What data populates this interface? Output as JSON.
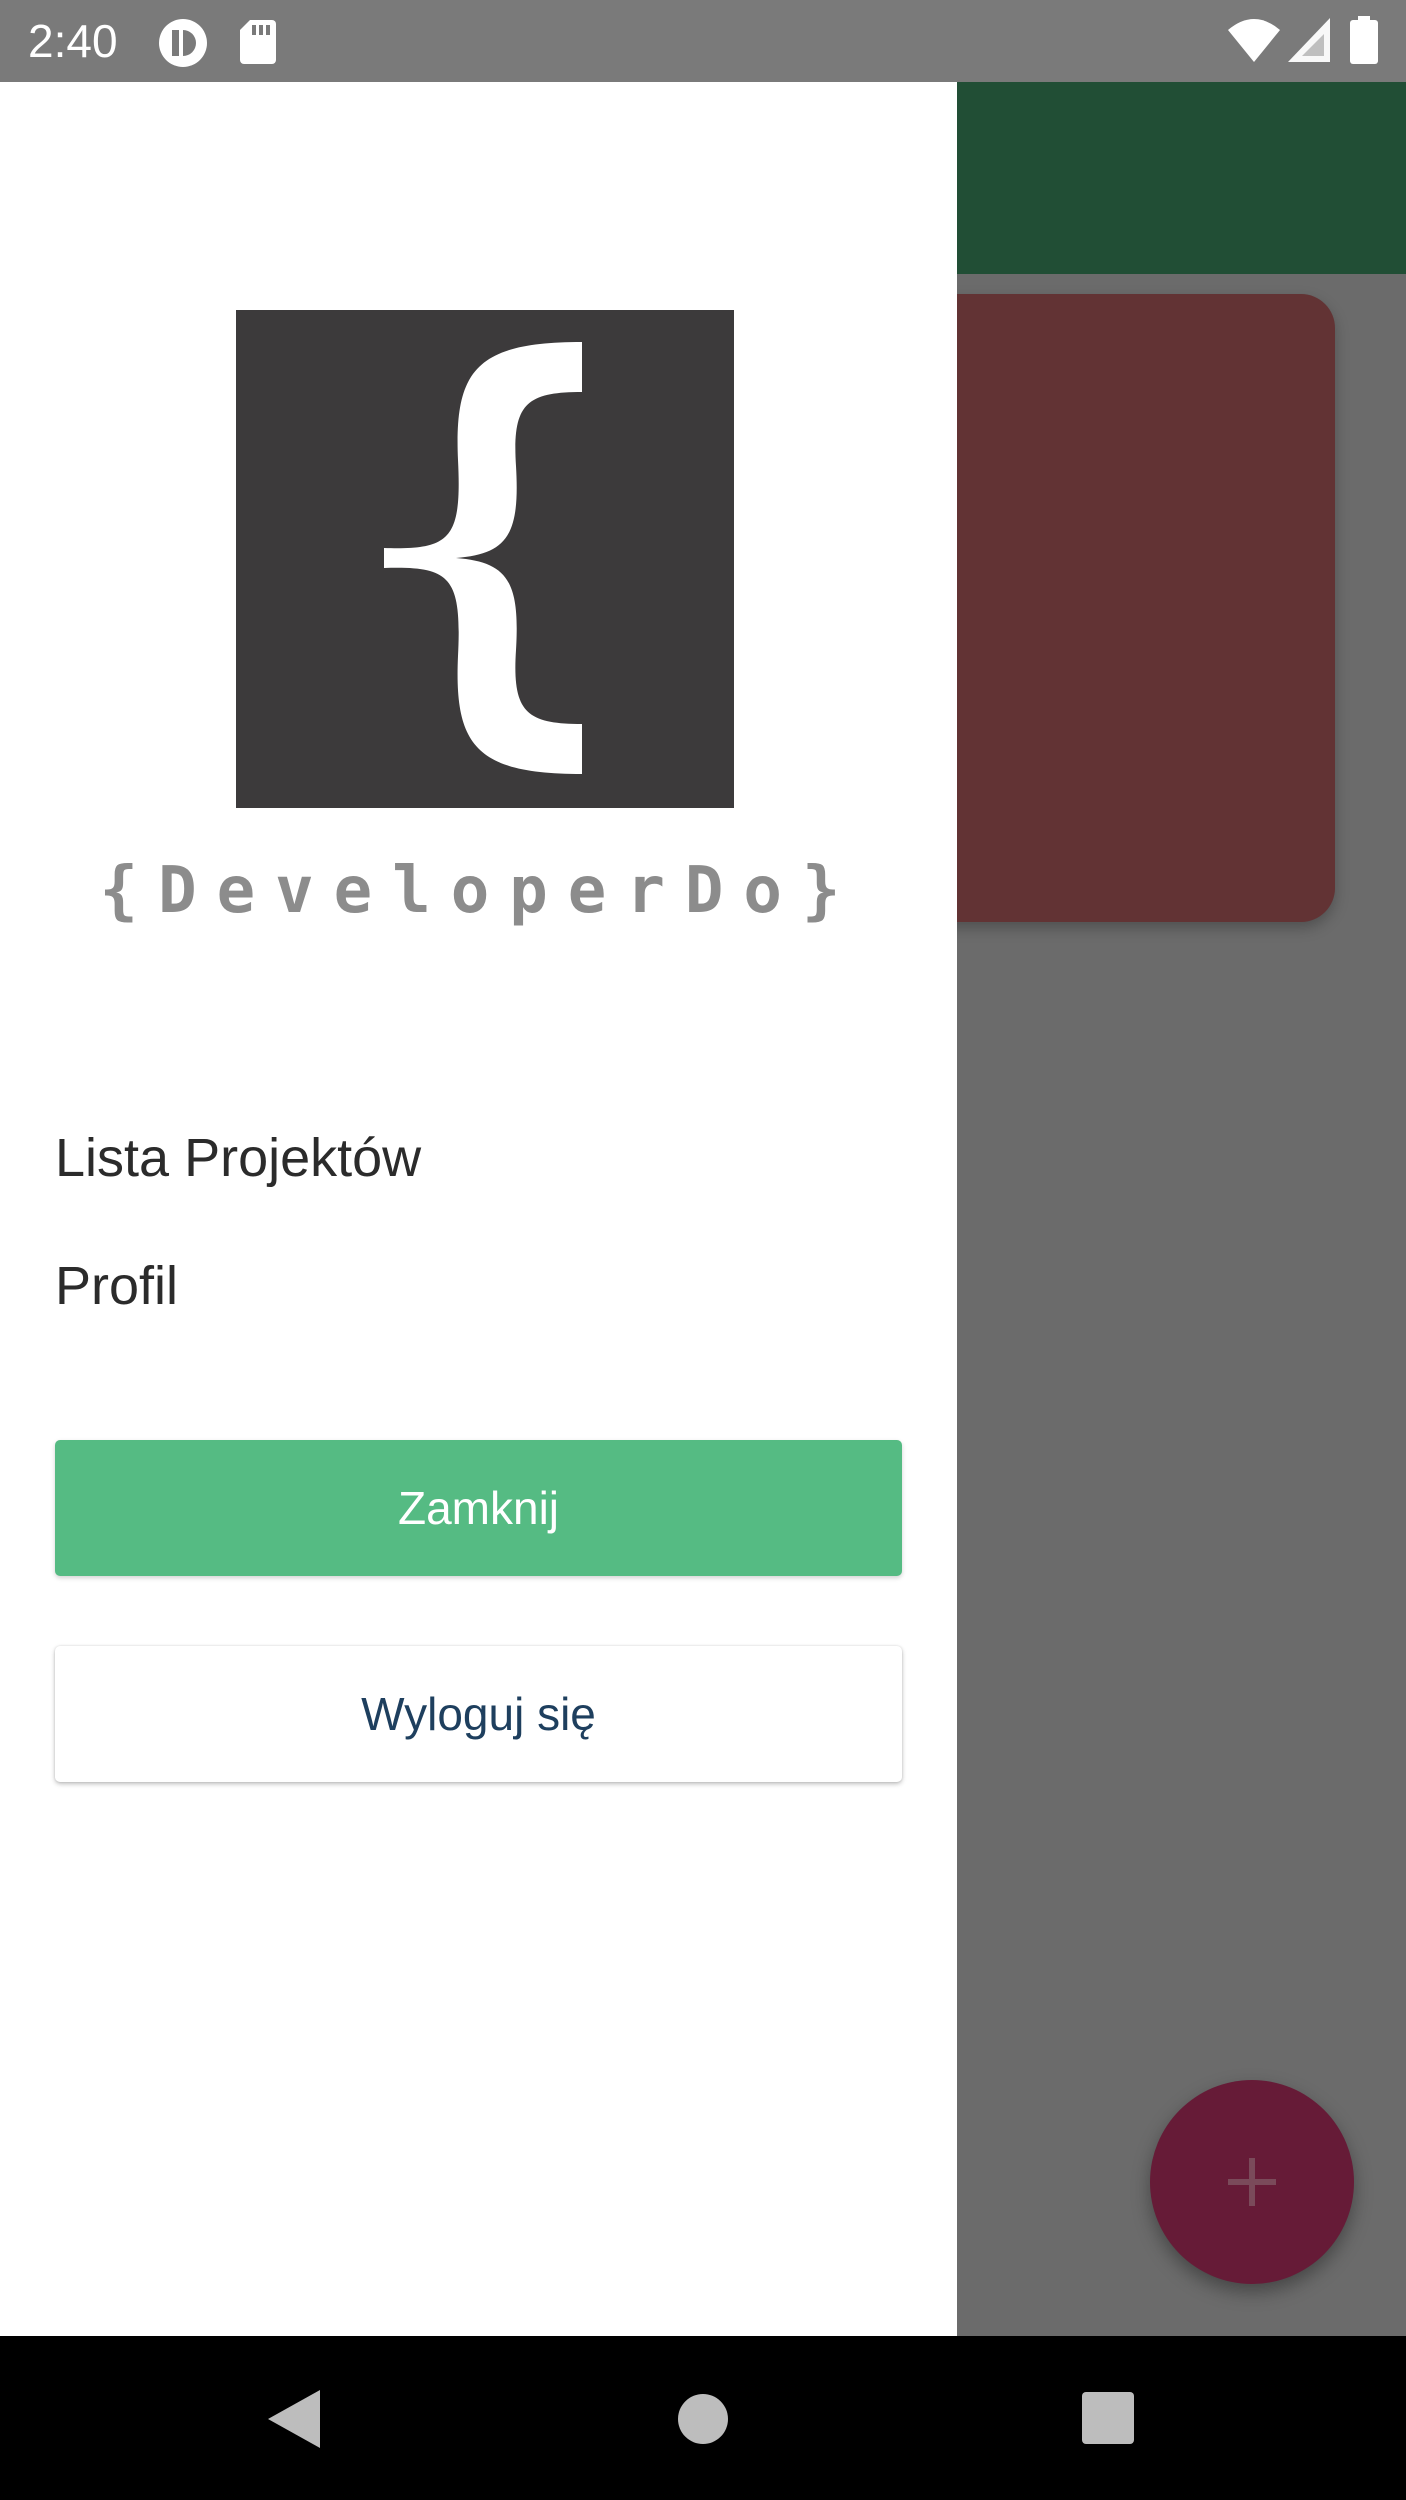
{
  "status_bar": {
    "time": "2:40",
    "icons": [
      "app-notification-icon",
      "sd-card-icon",
      "wifi-icon",
      "signal-icon",
      "battery-icon"
    ]
  },
  "drawer": {
    "logo": {
      "brand_text": "{DeveloperDo}",
      "icon": "curly-brace-logo-icon"
    },
    "menu": [
      {
        "label": "Lista Projektów"
      },
      {
        "label": "Profil"
      }
    ],
    "buttons": {
      "close_label": "Zamknij",
      "logout_label": "Wyloguj się"
    }
  },
  "background_app": {
    "fab_icon": "plus-icon"
  },
  "navigation_bar": {
    "icons": [
      "back-icon",
      "home-icon",
      "recents-icon"
    ]
  },
  "colors": {
    "accent_green": "#55bb83",
    "toolbar_green": "#214e35",
    "card_red": "#623334",
    "fab_red": "#661b37",
    "logout_text": "#1e3f5e"
  }
}
